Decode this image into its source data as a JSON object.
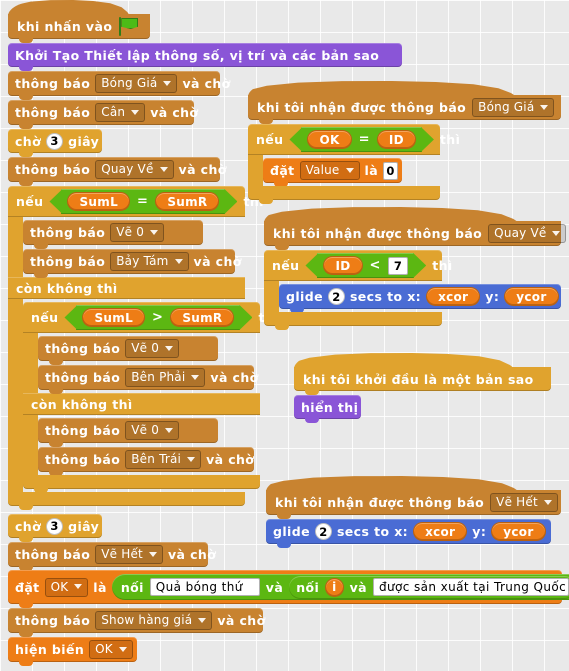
{
  "app": {
    "title": "Scratch Block Editor Canvas",
    "language": "vi"
  },
  "colors": {
    "events": "#c88330",
    "control": "#e0a32e",
    "motion": "#4a6cd4",
    "looks": "#8a55d7",
    "data": "#ee7d16",
    "operator": "#5cb712",
    "background": "#e9e9e9"
  },
  "scripts": {
    "main": {
      "hat": {
        "label_before": "khi nhấn vào",
        "icon": "green-flag-icon"
      },
      "custom_block": "Khởi Tạo Thiết lập thông số, vị trí và các bản sao",
      "broadcast1": {
        "pre": "thông báo",
        "value": "Bóng Giá",
        "post": "và chờ"
      },
      "broadcast2": {
        "pre": "thông báo",
        "value": "Cân",
        "post": "và chờ"
      },
      "wait1": {
        "pre": "chờ",
        "value": "3",
        "post": "giây"
      },
      "broadcast3": {
        "pre": "thông báo",
        "value": "Quay Về",
        "post": "và chờ"
      },
      "if1": {
        "pre": "nếu",
        "post": "thì",
        "cond": {
          "left": "SumL",
          "op": "=",
          "right": "SumR"
        },
        "then": [
          {
            "pre": "thông báo",
            "value": "Vẽ 0",
            "post": ""
          },
          {
            "pre": "thông báo",
            "value": "Bảy Tám",
            "post": "và chờ"
          }
        ],
        "else_label": "còn không thì",
        "if2": {
          "pre": "nếu",
          "post": "thì",
          "cond": {
            "left": "SumL",
            "op": ">",
            "right": "SumR"
          },
          "then": [
            {
              "pre": "thông báo",
              "value": "Vẽ 0",
              "post": ""
            },
            {
              "pre": "thông báo",
              "value": "Bên Phải",
              "post": "và chờ"
            }
          ],
          "else_label": "còn không thì",
          "else": [
            {
              "pre": "thông báo",
              "value": "Vẽ 0",
              "post": ""
            },
            {
              "pre": "thông báo",
              "value": "Bên Trái",
              "post": "và chờ"
            }
          ]
        }
      },
      "wait2": {
        "pre": "chờ",
        "value": "3",
        "post": "giây"
      },
      "broadcast4": {
        "pre": "thông báo",
        "value": "Vẽ Hết",
        "post": "và chờ"
      },
      "set_ok": {
        "pre": "đặt",
        "var": "OK",
        "mid": "là",
        "join_outer": {
          "label": "nối",
          "text": "Quả bóng thứ",
          "and": "và"
        },
        "join_inner": {
          "label": "nối",
          "var": "i",
          "and": "và",
          "text": "được sản xuất tại Trung Quốc"
        }
      },
      "broadcast5": {
        "pre": "thông báo",
        "value": "Show hàng giá",
        "post": "và chờ"
      },
      "show_var": {
        "pre": "hiện biến",
        "value": "OK"
      }
    },
    "on_bong_gia": {
      "hat": {
        "pre": "khi tôi nhận được thông báo",
        "value": "Bóng Giá"
      },
      "if": {
        "pre": "nếu",
        "post": "thì",
        "cond": {
          "left": "OK",
          "op": "=",
          "right": "ID"
        },
        "then": [
          {
            "pre": "đặt",
            "var": "Value",
            "mid": "là",
            "value": "0"
          }
        ]
      }
    },
    "on_quay_ve": {
      "hat": {
        "pre": "khi tôi nhận được thông báo",
        "value": "Quay Về"
      },
      "if": {
        "pre": "nếu",
        "post": "thì",
        "cond": {
          "left": "ID",
          "op": "<",
          "right": "7"
        },
        "then": [
          {
            "pre": "glide",
            "secs": "2",
            "mid": "secs to x:",
            "x": "xcor",
            "ylabel": "y:",
            "y": "ycor"
          }
        ]
      }
    },
    "on_clone": {
      "hat": {
        "label": "khi tôi khởi đầu là một bản sao"
      },
      "body": [
        {
          "label": "hiển thị"
        }
      ]
    },
    "on_ve_het": {
      "hat": {
        "pre": "khi tôi nhận được thông báo",
        "value": "Vẽ Hết"
      },
      "body": [
        {
          "pre": "glide",
          "secs": "2",
          "mid": "secs to x:",
          "x": "xcor",
          "ylabel": "y:",
          "y": "ycor"
        }
      ]
    }
  }
}
